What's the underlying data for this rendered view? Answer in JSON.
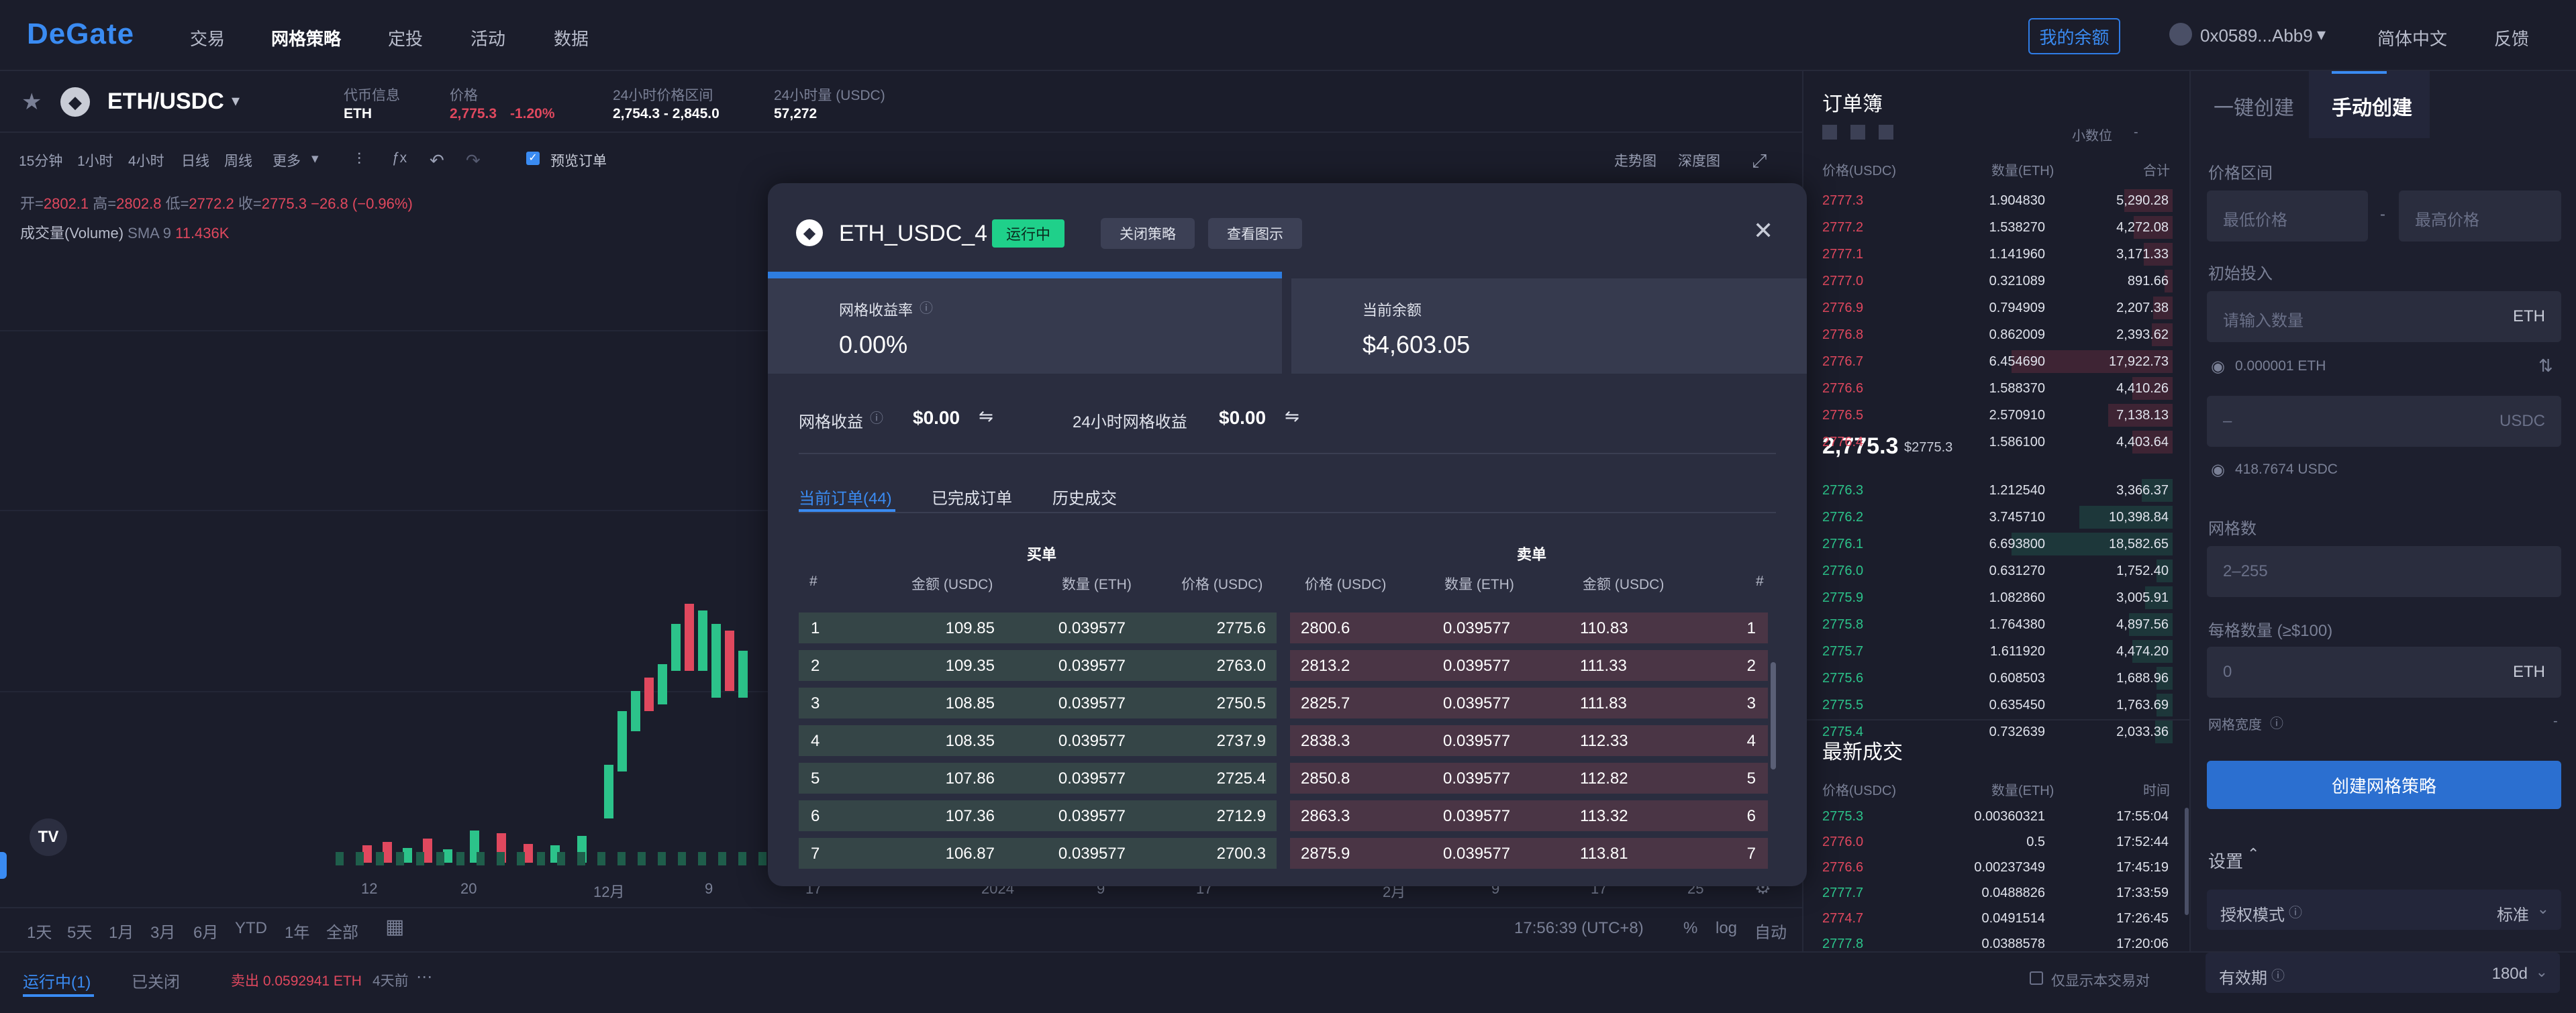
{
  "nav": {
    "logo": "DeGate",
    "items": [
      "交易",
      "网格策略",
      "定投",
      "活动",
      "数据"
    ],
    "balance": "我的余额",
    "account": "0x0589...Abb9",
    "language": "简体中文",
    "feedback": "反馈"
  },
  "ticker": {
    "pair": "ETH/USDC",
    "coin_label": "代币信息",
    "coin_value": "ETH",
    "price_label": "价格",
    "price_value": "2,775.3",
    "price_change": "-1.20%",
    "range_label": "24小时价格区间",
    "range_value": "2,754.3 - 2,845.0",
    "volume_label": "24小时量 (USDC)",
    "volume_value": "57,272"
  },
  "toolbar": {
    "intervals": [
      "15分钟",
      "1小时",
      "4小时",
      "日线",
      "周线",
      "更多"
    ],
    "preview_order": "预览订单",
    "trend": "走势图",
    "depth": "深度图"
  },
  "ohlc": {
    "open_label": "开=",
    "open": "2802.1",
    "high_label": "高=",
    "high": "2802.8",
    "low_label": "低=",
    "low": "2772.2",
    "close_label": "收=",
    "close": "2775.3",
    "change": "−26.8 (−0.96%)",
    "volume_label": "成交量(Volume)",
    "sma": "SMA 9",
    "volume_value": "11.436K"
  },
  "x_axis": [
    "12",
    "20",
    "12月",
    "9",
    "17",
    "2024",
    "9",
    "17",
    "2月",
    "9",
    "17",
    "25"
  ],
  "ranges": [
    "1天",
    "5天",
    "1月",
    "3月",
    "6月",
    "YTD",
    "1年",
    "全部"
  ],
  "chart_footer": {
    "time": "17:56:39 (UTC+8)",
    "pct": "%",
    "log": "log",
    "auto": "自动"
  },
  "bottom": {
    "tab_running": "运行中(1)",
    "tab_closed": "已关闭",
    "summary": "卖出 0.0592941 ETH",
    "duration": "4天前",
    "only_pair": "仅显示本交易对"
  },
  "orderbook": {
    "title": "订单簿",
    "decimals": "小数位",
    "decimals_value": "-",
    "col_price": "价格(USDC)",
    "col_amount": "数量(ETH)",
    "col_total": "合计",
    "asks": [
      {
        "price": "2777.3",
        "amount": "1.904830",
        "total": "5,290.28",
        "depth": 0.3
      },
      {
        "price": "2777.2",
        "amount": "1.538270",
        "total": "4,272.08",
        "depth": 0.24
      },
      {
        "price": "2777.1",
        "amount": "1.141960",
        "total": "3,171.33",
        "depth": 0.18
      },
      {
        "price": "2777.0",
        "amount": "0.321089",
        "total": "891.66",
        "depth": 0.05
      },
      {
        "price": "2776.9",
        "amount": "0.794909",
        "total": "2,207.38",
        "depth": 0.12
      },
      {
        "price": "2776.8",
        "amount": "0.862009",
        "total": "2,393.62",
        "depth": 0.13
      },
      {
        "price": "2776.7",
        "amount": "6.454690",
        "total": "17,922.73",
        "depth": 1.0
      },
      {
        "price": "2776.6",
        "amount": "1.588370",
        "total": "4,410.26",
        "depth": 0.25
      },
      {
        "price": "2776.5",
        "amount": "2.570910",
        "total": "7,138.13",
        "depth": 0.4
      },
      {
        "price": "2776.4",
        "amount": "1.586100",
        "total": "4,403.64",
        "depth": 0.25
      }
    ],
    "last_price": "2,775.3",
    "last_price_usd": "$2775.3",
    "bids": [
      {
        "price": "2776.3",
        "amount": "1.212540",
        "total": "3,366.37",
        "depth": 0.19
      },
      {
        "price": "2776.2",
        "amount": "3.745710",
        "total": "10,398.84",
        "depth": 0.58
      },
      {
        "price": "2776.1",
        "amount": "6.693800",
        "total": "18,582.65",
        "depth": 1.0
      },
      {
        "price": "2776.0",
        "amount": "0.631270",
        "total": "1,752.40",
        "depth": 0.1
      },
      {
        "price": "2775.9",
        "amount": "1.082860",
        "total": "3,005.91",
        "depth": 0.17
      },
      {
        "price": "2775.8",
        "amount": "1.764380",
        "total": "4,897.56",
        "depth": 0.27
      },
      {
        "price": "2775.7",
        "amount": "1.611920",
        "total": "4,474.20",
        "depth": 0.25
      },
      {
        "price": "2775.6",
        "amount": "0.608503",
        "total": "1,688.96",
        "depth": 0.1
      },
      {
        "price": "2775.5",
        "amount": "0.635450",
        "total": "1,763.69",
        "depth": 0.1
      },
      {
        "price": "2775.4",
        "amount": "0.732639",
        "total": "2,033.36",
        "depth": 0.11
      }
    ]
  },
  "trades": {
    "title": "最新成交",
    "col_price": "价格(USDC)",
    "col_amount": "数量(ETH)",
    "col_time": "时间",
    "rows": [
      {
        "price": "2775.3",
        "amount": "0.00360321",
        "time": "17:55:04",
        "side": "buy"
      },
      {
        "price": "2776.0",
        "amount": "0.5",
        "time": "17:52:44",
        "side": "sell"
      },
      {
        "price": "2776.6",
        "amount": "0.00237349",
        "time": "17:45:19",
        "side": "sell"
      },
      {
        "price": "2777.7",
        "amount": "0.0488826",
        "time": "17:33:59",
        "side": "buy"
      },
      {
        "price": "2774.7",
        "amount": "0.0491514",
        "time": "17:26:45",
        "side": "sell"
      },
      {
        "price": "2777.8",
        "amount": "0.0388578",
        "time": "17:20:06",
        "side": "buy"
      }
    ]
  },
  "panel": {
    "tab_quick": "一键创建",
    "tab_manual": "手动创建",
    "price_range": "价格区间",
    "min_price": "最低价格",
    "max_price": "最高价格",
    "dash": "-",
    "initial": "初始投入",
    "amount_ph": "请输入数量",
    "eth": "ETH",
    "eth_bal": "0.000001 ETH",
    "usdc_ph": "–",
    "usdc": "USDC",
    "usdc_bal": "418.7674 USDC",
    "grid_count": "网格数",
    "grid_ph": "2–255",
    "per_grid": "每格数量 (≥$100)",
    "per_grid_value": "0",
    "grid_width": "网格宽度",
    "grid_width_value": "-",
    "create": "创建网格策略",
    "settings": "设置",
    "auth_mode": "授权模式",
    "auth_value": "标准",
    "validity": "有效期",
    "validity_value": "180d"
  },
  "modal": {
    "title": "ETH_USDC_4",
    "status": "运行中",
    "close_strategy": "关闭策略",
    "view_chart": "查看图示",
    "yield_label": "网格收益率",
    "yield_value": "0.00%",
    "balance_label": "当前余额",
    "balance_value": "$4,603.05",
    "grid_profit_label": "网格收益",
    "grid_profit_value": "$0.00",
    "grid_profit_24h_label": "24小时网格收益",
    "grid_profit_24h_value": "$0.00",
    "tabs": [
      "当前订单(44)",
      "已完成订单",
      "历史成交"
    ],
    "buy_title": "买单",
    "sell_title": "卖单",
    "cols": [
      "#",
      "金额 (USDC)",
      "数量 (ETH)",
      "价格 (USDC)",
      "价格 (USDC)",
      "数量 (ETH)",
      "金额 (USDC)",
      "#"
    ],
    "rows": [
      {
        "n": "1",
        "b_amt": "109.85",
        "b_qty": "0.039577",
        "b_price": "2775.6",
        "s_price": "2800.6",
        "s_qty": "0.039577",
        "s_amt": "110.83"
      },
      {
        "n": "2",
        "b_amt": "109.35",
        "b_qty": "0.039577",
        "b_price": "2763.0",
        "s_price": "2813.2",
        "s_qty": "0.039577",
        "s_amt": "111.33"
      },
      {
        "n": "3",
        "b_amt": "108.85",
        "b_qty": "0.039577",
        "b_price": "2750.5",
        "s_price": "2825.7",
        "s_qty": "0.039577",
        "s_amt": "111.83"
      },
      {
        "n": "4",
        "b_amt": "108.35",
        "b_qty": "0.039577",
        "b_price": "2737.9",
        "s_price": "2838.3",
        "s_qty": "0.039577",
        "s_amt": "112.33"
      },
      {
        "n": "5",
        "b_amt": "107.86",
        "b_qty": "0.039577",
        "b_price": "2725.4",
        "s_price": "2850.8",
        "s_qty": "0.039577",
        "s_amt": "112.82"
      },
      {
        "n": "6",
        "b_amt": "107.36",
        "b_qty": "0.039577",
        "b_price": "2712.9",
        "s_price": "2863.3",
        "s_qty": "0.039577",
        "s_amt": "113.32"
      },
      {
        "n": "7",
        "b_amt": "106.87",
        "b_qty": "0.039577",
        "b_price": "2700.3",
        "s_price": "2875.9",
        "s_qty": "0.039577",
        "s_amt": "113.81"
      }
    ]
  },
  "colors": {
    "accent": "#3a8bf2",
    "up": "#2cc38a",
    "down": "#e0485e",
    "bg": "#1b1d2b",
    "modal_bg": "#2a2d3f"
  }
}
